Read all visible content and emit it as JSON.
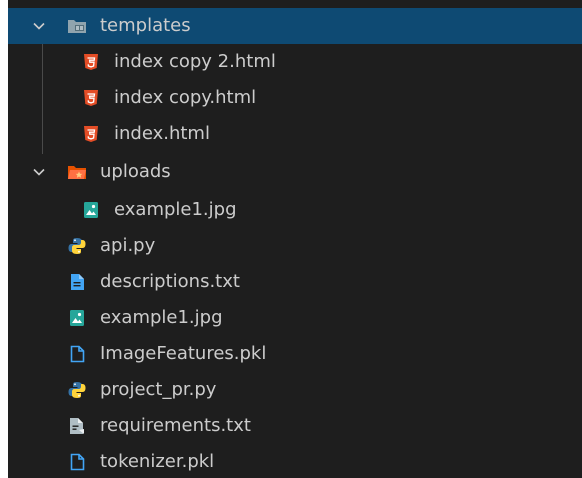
{
  "explorer": {
    "items": [
      {
        "label": "templates",
        "icon": "folder-templates-icon",
        "expanded": true,
        "selected": true
      },
      {
        "label": "index copy 2.html",
        "icon": "html-file-icon"
      },
      {
        "label": "index copy.html",
        "icon": "html-file-icon"
      },
      {
        "label": "index.html",
        "icon": "html-file-icon"
      },
      {
        "label": "uploads",
        "icon": "folder-uploads-icon",
        "expanded": true
      },
      {
        "label": "example1.jpg",
        "icon": "image-file-icon"
      },
      {
        "label": "api.py",
        "icon": "python-file-icon"
      },
      {
        "label": "descriptions.txt",
        "icon": "text-file-icon"
      },
      {
        "label": "example1.jpg",
        "icon": "image-file-icon"
      },
      {
        "label": "ImageFeatures.pkl",
        "icon": "generic-file-icon"
      },
      {
        "label": "project_pr.py",
        "icon": "python-file-icon"
      },
      {
        "label": "requirements.txt",
        "icon": "requirements-file-icon"
      },
      {
        "label": "tokenizer.pkl",
        "icon": "generic-file-icon"
      }
    ]
  },
  "colors": {
    "background": "#1e1e1e",
    "selection": "#0e4a73",
    "text": "#cccccc",
    "html": "#e44d26",
    "image": "#26a69a",
    "python_blue": "#3572a5",
    "python_yellow": "#ffd43b",
    "text_file": "#42a5f5",
    "folder_uploads": "#e65100",
    "folder_templates": "#90a4ae"
  }
}
